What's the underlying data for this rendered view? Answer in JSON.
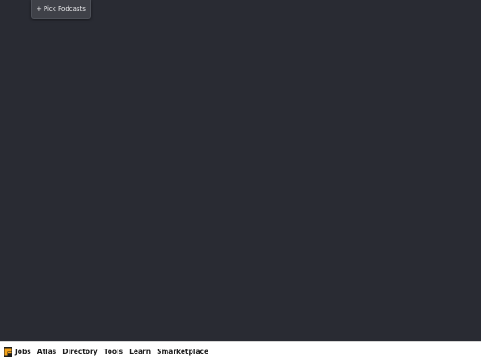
{
  "toolbar": {
    "pick_plus": "+",
    "pick_label": "Pick Podcasts"
  },
  "footer": {
    "logo_icon": "feed-logo-icon",
    "links": [
      "Jobs",
      "Atlas",
      "Directory",
      "Tools",
      "Learn",
      "Smarketplace"
    ]
  },
  "colors": {
    "background": "#292b33",
    "button": "#3f4148",
    "footer": "#ffffff",
    "logo_orange": "#f3a21a"
  }
}
